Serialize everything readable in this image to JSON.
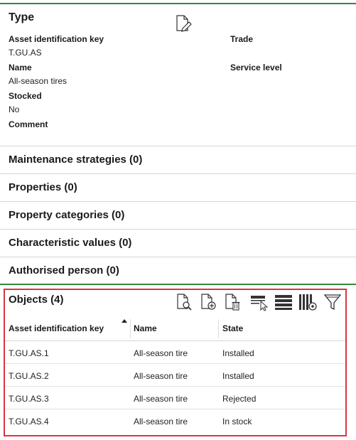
{
  "type": {
    "title": "Type",
    "fields": [
      {
        "label": "Asset identification key",
        "value": "T.GU.AS"
      },
      {
        "label": "Name",
        "value": "All-season tires"
      },
      {
        "label": "Stocked",
        "value": "No"
      },
      {
        "label": "Comment",
        "value": ""
      }
    ],
    "right_fields": [
      {
        "label": "Trade",
        "value": ""
      },
      {
        "label": "Service level",
        "value": ""
      }
    ]
  },
  "sections": [
    {
      "label": "Maintenance strategies (0)"
    },
    {
      "label": "Properties (0)"
    },
    {
      "label": "Property categories (0)"
    },
    {
      "label": "Characteristic values (0)"
    },
    {
      "label": "Authorised person (0)"
    }
  ],
  "objects": {
    "title": "Objects (4)",
    "toolbar_icons": [
      "view-document-icon",
      "add-document-icon",
      "delete-document-icon",
      "select-column-icon",
      "row-height-icon",
      "column-settings-icon",
      "filter-icon"
    ],
    "columns": [
      "Asset identification key",
      "Name",
      "State"
    ],
    "sorted_column": "Asset identification key",
    "sort_direction": "ascending",
    "rows": [
      {
        "key": "T.GU.AS.1",
        "name": "All-season tire",
        "state": "Installed"
      },
      {
        "key": "T.GU.AS.2",
        "name": "All-season tire",
        "state": "Installed"
      },
      {
        "key": "T.GU.AS.3",
        "name": "All-season tire",
        "state": "Rejected"
      },
      {
        "key": "T.GU.AS.4",
        "name": "All-season tire",
        "state": "In stock"
      }
    ]
  },
  "colors": {
    "accent_green": "#2e8b3a",
    "highlight_red": "#d9363e"
  }
}
